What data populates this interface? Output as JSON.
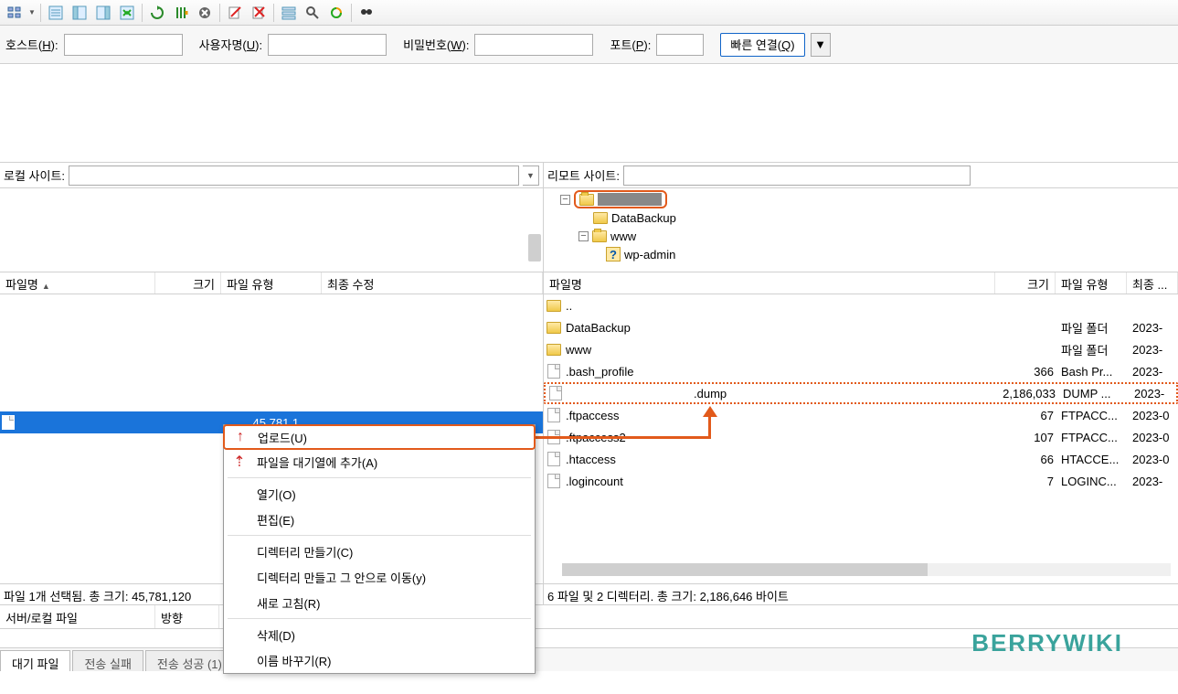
{
  "quickconnect": {
    "host_label_pre": "호스트(",
    "host_key": "H",
    "user_label_pre": "사용자명(",
    "user_key": "U",
    "pass_label_pre": "비밀번호(",
    "pass_key": "W",
    "port_label_pre": "포트(",
    "port_key": "P",
    "label_post": "):",
    "button_pre": "빠른 연결(",
    "button_key": "Q",
    "button_post": ")"
  },
  "sites": {
    "local_label": "로컬 사이트:",
    "remote_label": "리모트 사이트:"
  },
  "remote_tree": {
    "n1": "DataBackup",
    "n2": "www",
    "n3": "wp-admin"
  },
  "local_cols": {
    "name": "파일명",
    "size": "크기",
    "type": "파일 유형",
    "modified": "최종 수정"
  },
  "remote_cols": {
    "name": "파일명",
    "size": "크기",
    "type": "파일 유형",
    "modified": "최종 ..."
  },
  "local_selected": {
    "size": "45,781,1..."
  },
  "remote_files": {
    "up": "..",
    "r0": {
      "name": "DataBackup",
      "size": "",
      "type": "파일 폴더",
      "mod": "2023-"
    },
    "r1": {
      "name": "www",
      "size": "",
      "type": "파일 폴더",
      "mod": "2023-"
    },
    "r2": {
      "name": ".bash_profile",
      "size": "366",
      "type": "Bash Pr...",
      "mod": "2023-"
    },
    "r3": {
      "name": ".dump",
      "size": "2,186,033",
      "type": "DUMP ...",
      "mod": "2023-"
    },
    "r4": {
      "name": ".ftpaccess",
      "size": "67",
      "type": "FTPACC...",
      "mod": "2023-0"
    },
    "r5": {
      "name": ".ftpaccess2",
      "size": "107",
      "type": "FTPACC...",
      "mod": "2023-0"
    },
    "r6": {
      "name": ".htaccess",
      "size": "66",
      "type": "HTACCE...",
      "mod": "2023-0"
    },
    "r7": {
      "name": ".logincount",
      "size": "7",
      "type": "LOGINC...",
      "mod": "2023-"
    }
  },
  "status": {
    "local": "파일 1개 선택됨. 총 크기: 45,781,120",
    "remote": "6 파일 및 2 디렉터리. 총 크기: 2,186,646 바이트"
  },
  "ctx": {
    "upload": "업로드(U)",
    "addqueue": "파일을 대기열에 추가(A)",
    "open": "열기(O)",
    "edit": "편집(E)",
    "mkdir": "디렉터리 만들기(C)",
    "mkdir_enter": "디렉터리 만들고 그 안으로 이동(y)",
    "refresh": "새로 고침(R)",
    "delete": "삭제(D)",
    "rename": "이름 바꾸기(R)"
  },
  "qheader": {
    "c1": "서버/로컬 파일",
    "c2": "방향"
  },
  "tabs": {
    "t1": "대기 파일",
    "t2": "전송 실패",
    "t3": "전송 성공 (1)"
  },
  "watermark": "BERRYWIKI"
}
